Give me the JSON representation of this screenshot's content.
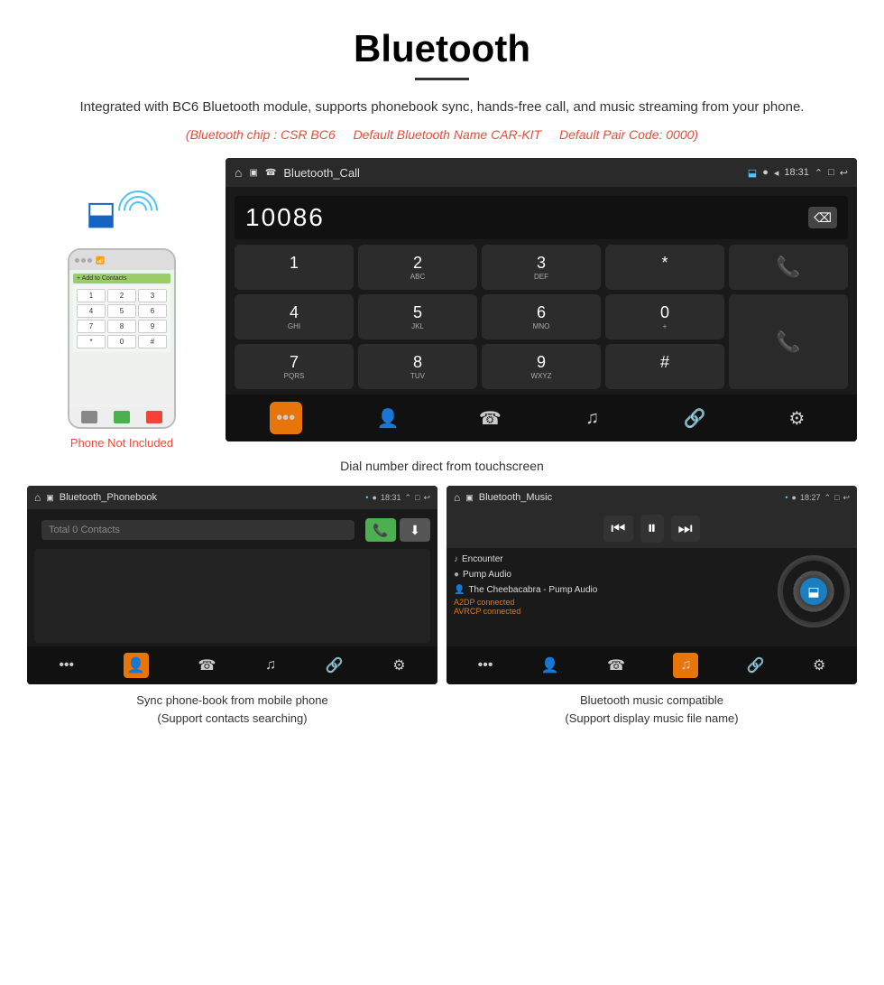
{
  "title": "Bluetooth",
  "subtitle": "Integrated with BC6 Bluetooth module, supports phonebook sync, hands-free call, and music streaming from your phone.",
  "specs": {
    "chip": "(Bluetooth chip : CSR BC6",
    "name": "Default Bluetooth Name CAR-KIT",
    "code": "Default Pair Code: 0000)"
  },
  "phone_not_included": "Phone Not Included",
  "dial_screen": {
    "status_title": "Bluetooth_Call",
    "time": "18:31",
    "number": "10086",
    "keys": [
      {
        "main": "1",
        "sub": ""
      },
      {
        "main": "2",
        "sub": "ABC"
      },
      {
        "main": "3",
        "sub": "DEF"
      },
      {
        "main": "*",
        "sub": ""
      },
      {
        "main": "📞",
        "sub": ""
      },
      {
        "main": "4",
        "sub": "GHI"
      },
      {
        "main": "5",
        "sub": "JKL"
      },
      {
        "main": "6",
        "sub": "MNO"
      },
      {
        "main": "0",
        "sub": "+"
      },
      {
        "main": "📞",
        "sub": ""
      },
      {
        "main": "7",
        "sub": "PQRS"
      },
      {
        "main": "8",
        "sub": "TUV"
      },
      {
        "main": "9",
        "sub": "WXYZ"
      },
      {
        "main": "#",
        "sub": ""
      },
      {
        "main": "📞",
        "sub": ""
      }
    ]
  },
  "dial_caption": "Dial number direct from touchscreen",
  "phonebook_screen": {
    "status_title": "Bluetooth_Phonebook",
    "time": "18:31",
    "search_placeholder": "Total 0 Contacts"
  },
  "phonebook_caption_line1": "Sync phone-book from mobile phone",
  "phonebook_caption_line2": "(Support contacts searching)",
  "music_screen": {
    "status_title": "Bluetooth_Music",
    "time": "18:27",
    "track1": "Encounter",
    "track2": "Pump Audio",
    "track3": "The Cheebacabra - Pump Audio",
    "connected1": "A2DP connected",
    "connected2": "AVRCP connected"
  },
  "music_caption_line1": "Bluetooth music compatible",
  "music_caption_line2": "(Support display music file name)"
}
